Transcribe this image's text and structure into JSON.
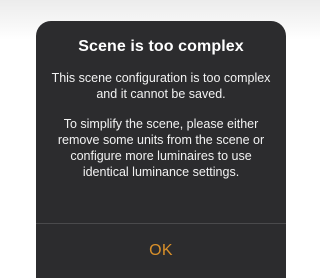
{
  "dialog": {
    "title": "Scene is too complex",
    "message_1": "This scene configuration is too complex and it cannot be saved.",
    "message_2": "To simplify the scene, please either remove some units from the scene or configure more luminaires to use identical luminance settings.",
    "ok_label": "OK"
  },
  "colors": {
    "dialog_background": "#2c2c2e",
    "accent": "#d9902a",
    "text": "#ffffff",
    "divider": "#4a4a4c"
  }
}
